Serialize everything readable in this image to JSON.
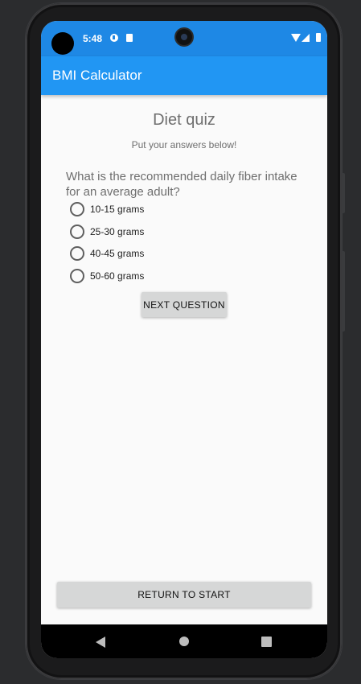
{
  "status_bar": {
    "time": "5:48"
  },
  "app_bar": {
    "title": "BMI Calculator"
  },
  "quiz": {
    "title": "Diet quiz",
    "subtitle": "Put your answers below!",
    "question": "What is the recommended daily fiber intake for an average adult?",
    "options": [
      {
        "label": "10-15 grams",
        "selected": false
      },
      {
        "label": "25-30 grams",
        "selected": false
      },
      {
        "label": "40-45 grams",
        "selected": false
      },
      {
        "label": "50-60 grams",
        "selected": false
      }
    ],
    "next_label": "NEXT QUESTION",
    "return_label": "RETURN TO START"
  },
  "icons": {
    "status": [
      "sim-icon",
      "sd-card-icon",
      "wifi-icon",
      "signal-icon",
      "battery-icon"
    ],
    "nav": [
      "back-icon",
      "home-icon",
      "recents-icon"
    ]
  },
  "colors": {
    "status_bar": "#1e88e5",
    "app_bar": "#2196f3",
    "background": "#fafafa",
    "button": "#d6d7d7",
    "text_muted": "#6e6e6e"
  }
}
